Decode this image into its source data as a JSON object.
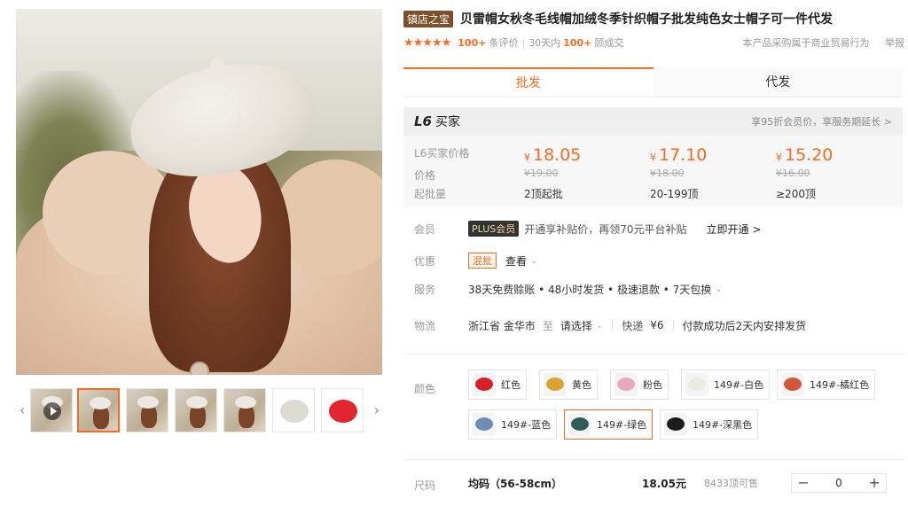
{
  "gallery": {
    "thumbnails": [
      {
        "kind": "video"
      },
      {
        "kind": "photo",
        "active": true
      },
      {
        "kind": "photo"
      },
      {
        "kind": "photo"
      },
      {
        "kind": "photo"
      },
      {
        "kind": "hat",
        "color": "#dcdad3"
      },
      {
        "kind": "hat",
        "color": "#e1262f"
      }
    ]
  },
  "product": {
    "shop_badge": "镇店之宝",
    "title": "贝雷帽女秋冬毛线帽加绒冬季针织帽子批发纯色女士帽子可一件代发",
    "stars": "★★★★★",
    "review_count": "100+",
    "review_label": "条评价",
    "sold_prefix": "30天内",
    "sold_count": "100+",
    "sold_label": "顾成交",
    "trade_note": "本产品采购属于商业贸易行为",
    "report": "举报"
  },
  "tabs": [
    {
      "label": "批发",
      "active": true
    },
    {
      "label": "代发",
      "active": false
    }
  ],
  "pricing": {
    "level": "L6",
    "level_label": "买家",
    "member_hint": "享95折会员价，享服务期延长 >",
    "rows": {
      "buyer_price_label": "L6买家价格",
      "price_label": "价格",
      "moq_label": "起批量"
    },
    "currency": "¥",
    "tiers": [
      {
        "price": "18.05",
        "original": "¥19.00",
        "qty": "2顶起批"
      },
      {
        "price": "17.10",
        "original": "¥18.00",
        "qty": "20-199顶"
      },
      {
        "price": "15.20",
        "original": "¥16.00",
        "qty": "≥200顶"
      }
    ]
  },
  "attributes": {
    "member": {
      "label": "会员",
      "badge": "PLUS会员",
      "text": "开通享补贴价，再领70元平台补贴",
      "link": "立即开通 >"
    },
    "promo": {
      "label": "优惠",
      "tag": "混批",
      "link": "查看"
    },
    "service": {
      "label": "服务",
      "text": "38天免费赊账 • 48小时发货 • 极速退款 • 7天包换"
    },
    "logistics": {
      "label": "物流",
      "from": "浙江省 金华市",
      "to_label": "至",
      "to": "请选择",
      "shipping_label": "快递",
      "shipping_fee": "¥6",
      "ship_note": "付款成功后2天内安排发货"
    }
  },
  "colors": {
    "label": "颜色",
    "options": [
      {
        "name": "红色",
        "hex": "#d8202a",
        "active": false
      },
      {
        "name": "黄色",
        "hex": "#d9a235",
        "active": false
      },
      {
        "name": "粉色",
        "hex": "#e9a8c0",
        "active": false
      },
      {
        "name": "149#-白色",
        "hex": "#ece9e2",
        "active": false
      },
      {
        "name": "149#-橘红色",
        "hex": "#d1563c",
        "active": false
      },
      {
        "name": "149#-蓝色",
        "hex": "#6d8db5",
        "active": false
      },
      {
        "name": "149#-绿色",
        "hex": "#2f5d5a",
        "active": true
      },
      {
        "name": "149#-深黑色",
        "hex": "#1c1c1c",
        "active": false
      }
    ]
  },
  "size": {
    "label": "尺码",
    "name": "均码（56-58cm）",
    "price": "18.05元",
    "stock": "8433顶可售",
    "minus": "−",
    "qty": "0",
    "plus": "+"
  }
}
